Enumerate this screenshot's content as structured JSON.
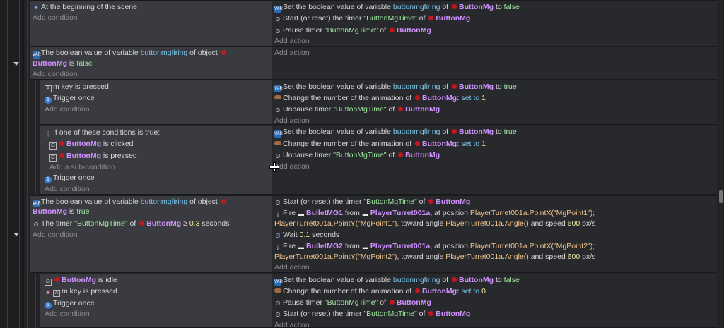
{
  "events": {
    "e1": {
      "cond": "At the beginning of the scene",
      "add_condition": "Add condition",
      "a1": {
        "pre": "Set the boolean value of variable",
        "var": "buttonmgfiring",
        "of": "of",
        "obj": "ButtonMg",
        "to": "to",
        "val": "false"
      },
      "a2": {
        "pre": "Start (or reset) the timer",
        "str": "\"ButtonMgTime\"",
        "of": "of",
        "obj": "ButtonMg"
      },
      "a3": {
        "pre": "Pause timer",
        "str": "\"ButtonMgTime\"",
        "of": "of",
        "obj": "ButtonMg"
      },
      "add_action": "Add action"
    },
    "e2": {
      "c1": {
        "pre": "The boolean value of variable",
        "var": "buttonmgfiring",
        "mid": "of object",
        "obj": "ButtonMg",
        "is": "is",
        "val": "false"
      },
      "add_condition": "Add condition",
      "add_action": "Add action"
    },
    "e3": {
      "c1": {
        "key": "m",
        "rest": "key is pressed"
      },
      "c2": "Trigger once",
      "add_condition": "Add condition",
      "a1": {
        "pre": "Set the boolean value of variable",
        "var": "buttonmgfiring",
        "of": "of",
        "obj": "ButtonMg",
        "to": "to",
        "val": "true"
      },
      "a2": {
        "pre": "Change the number of the animation of",
        "obj": "ButtonMg:",
        "setto": "set to",
        "val": "1"
      },
      "a3": {
        "pre": "Unpause timer",
        "str": "\"ButtonMgTime\"",
        "of": "of",
        "obj": "ButtonMg"
      },
      "add_action": "Add action"
    },
    "e4": {
      "c1": "If one of these conditions is true:",
      "s1": {
        "obj": "ButtonMg",
        "rest": "is clicked"
      },
      "s2": {
        "obj": "ButtonMg",
        "rest": "is pressed"
      },
      "add_sub": "Add a sub-condition",
      "c2": "Trigger once",
      "add_condition": "Add condition",
      "a1": {
        "pre": "Set the boolean value of variable",
        "var": "buttonmgfiring",
        "of": "of",
        "obj": "ButtonMg",
        "to": "to",
        "val": "true"
      },
      "a2": {
        "pre": "Change the number of the animation of",
        "obj": "ButtonMg:",
        "setto": "set to",
        "val": "1"
      },
      "a3": {
        "pre": "Unpause timer",
        "str": "\"ButtonMgTime\"",
        "of": "of",
        "obj": "ButtonMg"
      },
      "add_action": "Add action"
    },
    "e5": {
      "c1": {
        "pre": "The boolean value of variable",
        "var": "buttonmgfiring",
        "mid": "of object",
        "obj": "ButtonMg",
        "is": "is",
        "val": "true"
      },
      "c2": {
        "pre": "The timer",
        "str": "\"ButtonMgTime\"",
        "of": "of",
        "obj": "ButtonMg",
        "op": "≥",
        "num": "0.3",
        "unit": "seconds"
      },
      "add_condition": "Add condition",
      "a1": {
        "pre": "Start (or reset) the timer",
        "str": "\"ButtonMgTime\"",
        "of": "of",
        "obj": "ButtonMg"
      },
      "a2": {
        "pre": "Fire",
        "bullet": "BulletMG1",
        "from": "from",
        "turret": "PlayerTurret001a,",
        "atpos": "at position",
        "px": "PlayerTurret001a.PointX(\"MgPoint1\");",
        "py": "PlayerTurret001a.PointY(\"MgPoint1\"),",
        "toward": "toward angle",
        "angle": "PlayerTurret001a.Angle()",
        "speed": "and speed",
        "sval": "600",
        "unit": "px/s"
      },
      "a3": {
        "pre": "Wait",
        "num": "0.1",
        "unit": "seconds"
      },
      "a4": {
        "pre": "Fire",
        "bullet": "BulletMG2",
        "from": "from",
        "turret": "PlayerTurret001a,",
        "atpos": "at position",
        "px": "PlayerTurret001a.PointX(\"MgPoint2\");",
        "py": "PlayerTurret001a.PointY(\"MgPoint2\"),",
        "toward": "toward angle",
        "angle": "PlayerTurret001a.Angle()",
        "speed": "and speed",
        "sval": "600",
        "unit": "px/s"
      },
      "add_action": "Add action"
    },
    "e6": {
      "c1": {
        "obj": "ButtonMg",
        "rest": "is idle"
      },
      "c2": {
        "key": "m",
        "rest": "key is pressed"
      },
      "c3": "Trigger once",
      "add_condition": "Add condition",
      "a1": {
        "pre": "Set the boolean value of variable",
        "var": "buttonmgfiring",
        "of": "of",
        "obj": "ButtonMg",
        "to": "to",
        "val": "false"
      },
      "a2": {
        "pre": "Change the number of the animation of",
        "obj": "ButtonMg:",
        "setto": "set to",
        "val": "0"
      },
      "a3": {
        "pre": "Pause timer",
        "str": "\"ButtonMgTime\"",
        "of": "of",
        "obj": "ButtonMg"
      },
      "a4": {
        "pre": "Start (or reset) the timer",
        "str": "\"ButtonMgTime\"",
        "of": "of",
        "obj": "ButtonMg"
      },
      "add_action": "Add action"
    }
  },
  "icons": {
    "var": "var-icon",
    "timer": "timer-icon",
    "anim": "animation-icon",
    "key": "keyboard-icon",
    "once": "trigger-once-icon",
    "mouse": "mouse-icon",
    "bullet": "bullet-icon",
    "wait": "wait-icon",
    "scene": "scene-icon",
    "object": "object-icon"
  },
  "colors": {
    "object": "#cf92ff",
    "variable": "#78c4e8",
    "string": "#a0e6a0",
    "number": "#f4e9a3",
    "expression": "#f0c48a",
    "object_dot": "#c0181f"
  }
}
